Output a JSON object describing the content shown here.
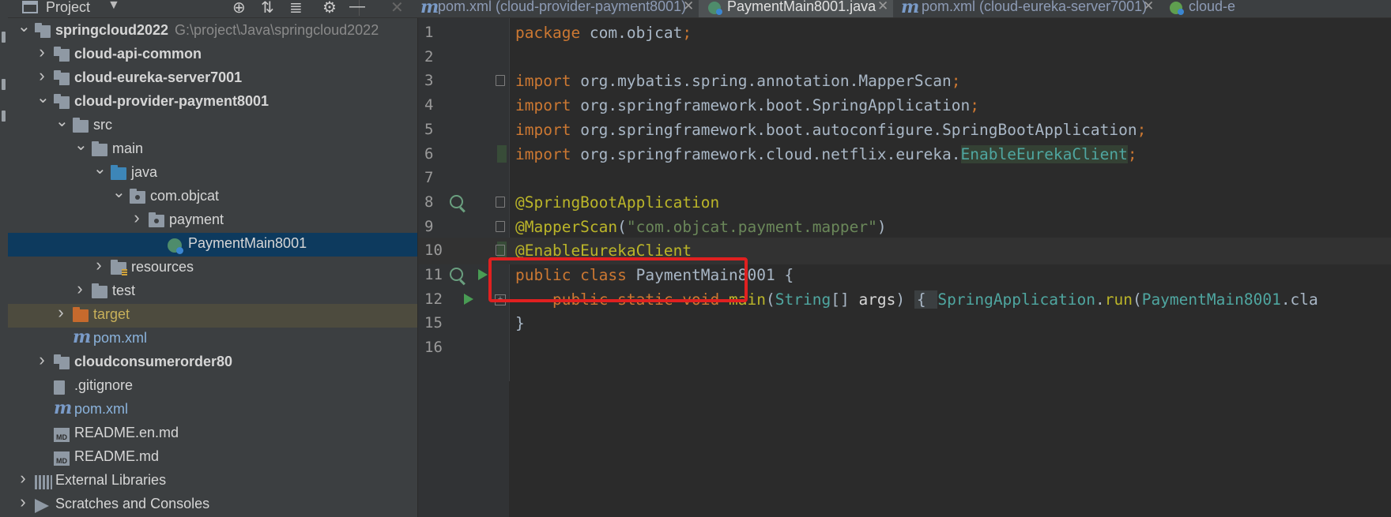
{
  "project_panel": {
    "title": "Project",
    "icons": [
      "crosshair-icon",
      "expand-all-icon",
      "collapse-all-icon",
      "gear-icon",
      "minimize-icon"
    ]
  },
  "tabs": [
    {
      "label": "pom.xml (cloud-provider-payment8001)",
      "icon": "maven-icon",
      "active": false
    },
    {
      "label": "PaymentMain8001.java",
      "icon": "java-class-icon",
      "active": true
    },
    {
      "label": "pom.xml (cloud-eureka-server7001)",
      "icon": "maven-icon",
      "active": false
    },
    {
      "label": "cloud-e",
      "icon": "spring-icon",
      "active": false
    }
  ],
  "tree": [
    {
      "label": "springcloud2022",
      "path": "G:\\project\\Java\\springcloud2022",
      "bold": true,
      "expanded": true,
      "icon": "module-folder-icon"
    },
    {
      "label": "cloud-api-common",
      "bold": true,
      "expanded": false,
      "icon": "module-folder-icon"
    },
    {
      "label": "cloud-eureka-server7001",
      "bold": true,
      "expanded": false,
      "icon": "module-folder-icon"
    },
    {
      "label": "cloud-provider-payment8001",
      "bold": true,
      "expanded": true,
      "icon": "module-folder-icon"
    },
    {
      "label": "src",
      "expanded": true,
      "icon": "folder-icon"
    },
    {
      "label": "main",
      "expanded": true,
      "icon": "folder-icon"
    },
    {
      "label": "java",
      "expanded": true,
      "icon": "source-folder-icon"
    },
    {
      "label": "com.objcat",
      "expanded": true,
      "icon": "package-icon"
    },
    {
      "label": "payment",
      "expanded": false,
      "icon": "package-icon"
    },
    {
      "label": "PaymentMain8001",
      "selected": true,
      "icon": "spring-boot-class-icon"
    },
    {
      "label": "resources",
      "expanded": false,
      "icon": "resources-folder-icon"
    },
    {
      "label": "test",
      "expanded": false,
      "icon": "folder-icon"
    },
    {
      "label": "target",
      "expanded": false,
      "excluded": true,
      "icon": "excluded-folder-icon"
    },
    {
      "label": "pom.xml",
      "icon": "maven-icon"
    },
    {
      "label": "cloudconsumerorder80",
      "bold": true,
      "expanded": false,
      "icon": "module-folder-icon"
    },
    {
      "label": ".gitignore",
      "icon": "ignore-file-icon"
    },
    {
      "label": "pom.xml",
      "icon": "maven-icon"
    },
    {
      "label": "README.en.md",
      "icon": "markdown-icon"
    },
    {
      "label": "README.md",
      "icon": "markdown-icon"
    },
    {
      "label": "External Libraries",
      "expanded": false,
      "icon": "library-icon"
    },
    {
      "label": "Scratches and Consoles",
      "expanded": false,
      "icon": "scratches-icon"
    }
  ],
  "editor": {
    "lines": [
      {
        "n": "1",
        "parts": [
          [
            "kw",
            "package "
          ],
          [
            "iden",
            "com.objcat"
          ],
          [
            "kw",
            ";"
          ]
        ]
      },
      {
        "n": "2",
        "parts": []
      },
      {
        "n": "3",
        "parts": [
          [
            "kw",
            "import "
          ],
          [
            "iden",
            "org.mybatis.spring.annotation."
          ],
          [
            "iden",
            "MapperScan"
          ],
          [
            "kw",
            ";"
          ]
        ]
      },
      {
        "n": "4",
        "parts": [
          [
            "kw",
            "import "
          ],
          [
            "iden",
            "org.springframework.boot."
          ],
          [
            "iden",
            "SpringApplication"
          ],
          [
            "kw",
            ";"
          ]
        ]
      },
      {
        "n": "5",
        "parts": [
          [
            "kw",
            "import "
          ],
          [
            "iden",
            "org.springframework.boot.autoconfigure."
          ],
          [
            "iden",
            "SpringBootApplication"
          ],
          [
            "kw",
            ";"
          ]
        ]
      },
      {
        "n": "6",
        "parts": [
          [
            "kw",
            "import "
          ],
          [
            "iden",
            "org.springframework.cloud.netflix.eureka."
          ],
          [
            "hl cls",
            "EnableEurekaClient"
          ],
          [
            "kw",
            ";"
          ]
        ]
      },
      {
        "n": "7",
        "parts": []
      },
      {
        "n": "8",
        "parts": [
          [
            "an",
            "@SpringBootApplication"
          ]
        ]
      },
      {
        "n": "9",
        "parts": [
          [
            "an",
            "@MapperScan"
          ],
          [
            "iden",
            "("
          ],
          [
            "str",
            "\"com.objcat.payment.mapper\""
          ],
          [
            "iden",
            ")"
          ]
        ]
      },
      {
        "n": "10",
        "parts": [
          [
            "an",
            "@EnableEurekaClient"
          ]
        ]
      },
      {
        "n": "11",
        "parts": [
          [
            "kw",
            "public class "
          ],
          [
            "iden",
            "PaymentMain8001 {"
          ]
        ]
      },
      {
        "n": "12",
        "parts": [
          [
            "kw",
            "    public static void "
          ],
          [
            "an",
            "main"
          ],
          [
            "iden",
            "("
          ],
          [
            "cls",
            "String"
          ],
          [
            "iden",
            "[] "
          ],
          [
            "param",
            "args"
          ],
          [
            "iden",
            ") "
          ],
          [
            "brace-fold iden",
            "{ "
          ],
          [
            "cls",
            "SpringApplication"
          ],
          [
            "iden",
            "."
          ],
          [
            "an",
            "run"
          ],
          [
            "iden",
            "("
          ],
          [
            "cls",
            "PaymentMain8001"
          ],
          [
            "iden",
            ".cla"
          ]
        ]
      },
      {
        "n": "15",
        "parts": [
          [
            "iden",
            "}"
          ]
        ]
      },
      {
        "n": "16",
        "parts": []
      }
    ]
  }
}
